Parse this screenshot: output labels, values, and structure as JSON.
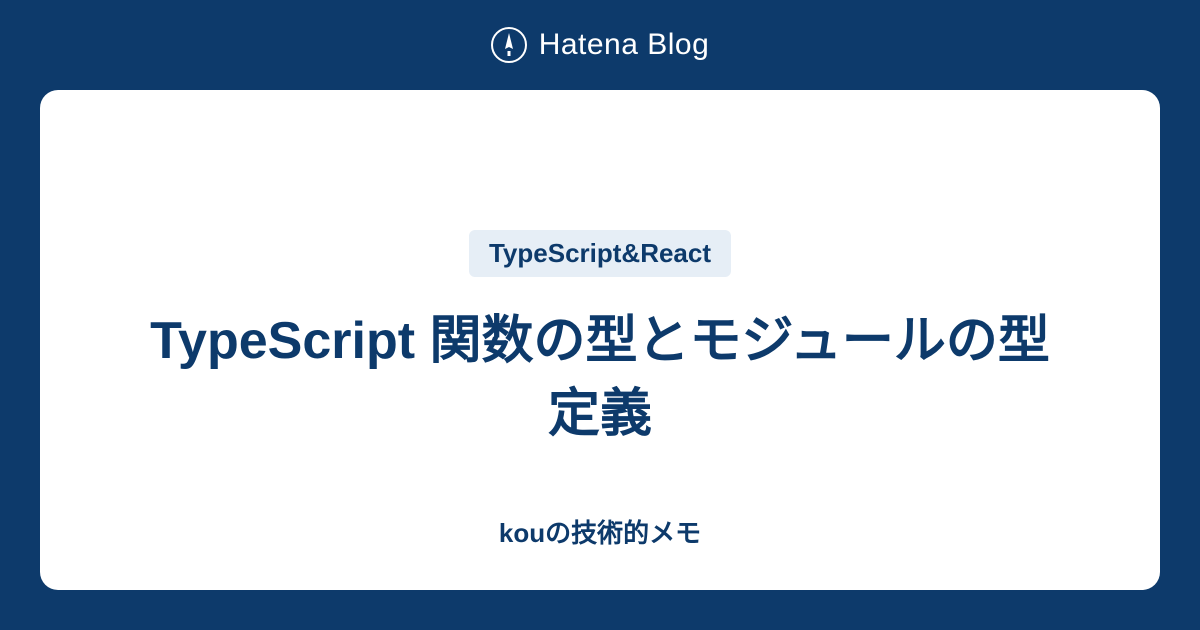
{
  "header": {
    "brand_name": "Hatena Blog",
    "icon_name": "pen-icon"
  },
  "card": {
    "category": "TypeScript&React",
    "title": "TypeScript 関数の型とモジュールの型定義",
    "author": "kouの技術的メモ"
  },
  "colors": {
    "background": "#0d3a6b",
    "card_background": "#ffffff",
    "chip_background": "#e6eef6",
    "text_primary": "#0d3a6b",
    "text_light": "#ffffff"
  }
}
